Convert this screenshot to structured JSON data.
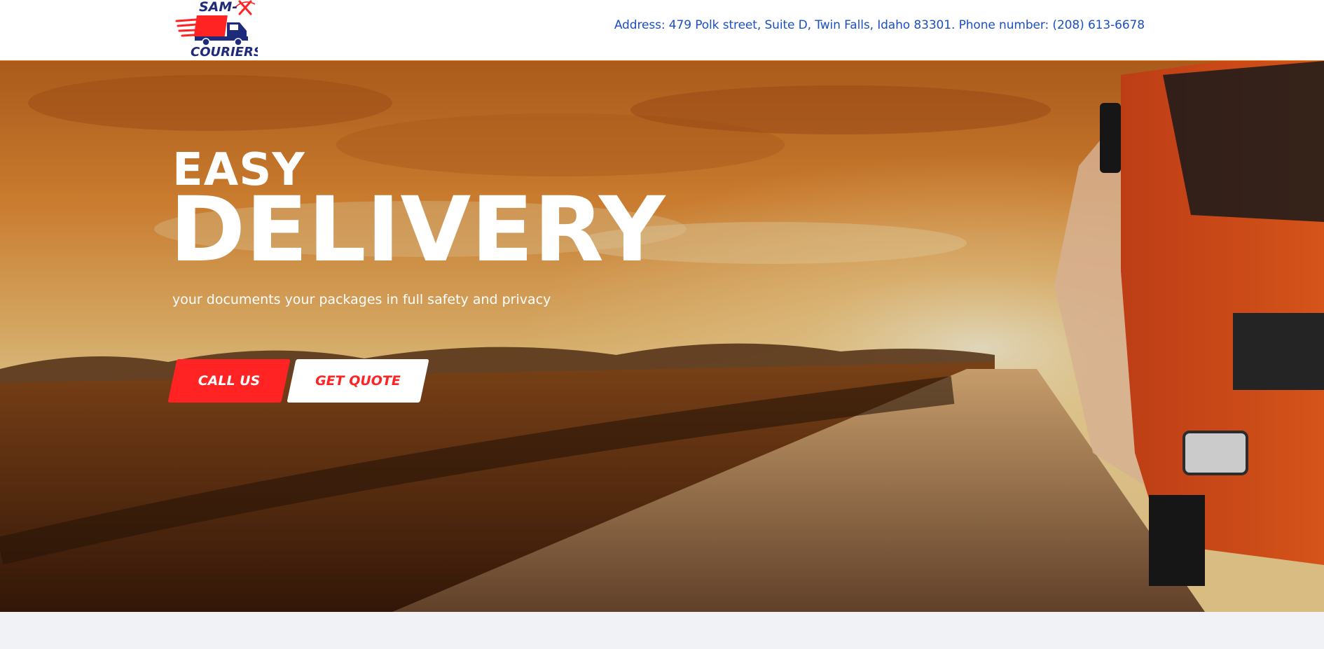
{
  "header": {
    "logo": {
      "top_text": "SAM-",
      "bottom_text": "COURIERS",
      "colors": {
        "primary": "#1e2a7a",
        "accent": "#ff2323"
      }
    },
    "address_line": "Address: 479 Polk street, Suite D, Twin Falls, Idaho 83301. Phone number: (208) 613-6678"
  },
  "hero": {
    "title_small": "EASY",
    "title_large": "DELIVERY",
    "subtitle": "your documents your packages in full safety and privacy",
    "buttons": {
      "call": "CALL US",
      "quote": "GET QUOTE"
    },
    "background": "sunset-highway-with-orange-truck",
    "colors": {
      "accent": "#ff2323",
      "sky": "#e7892f"
    }
  }
}
